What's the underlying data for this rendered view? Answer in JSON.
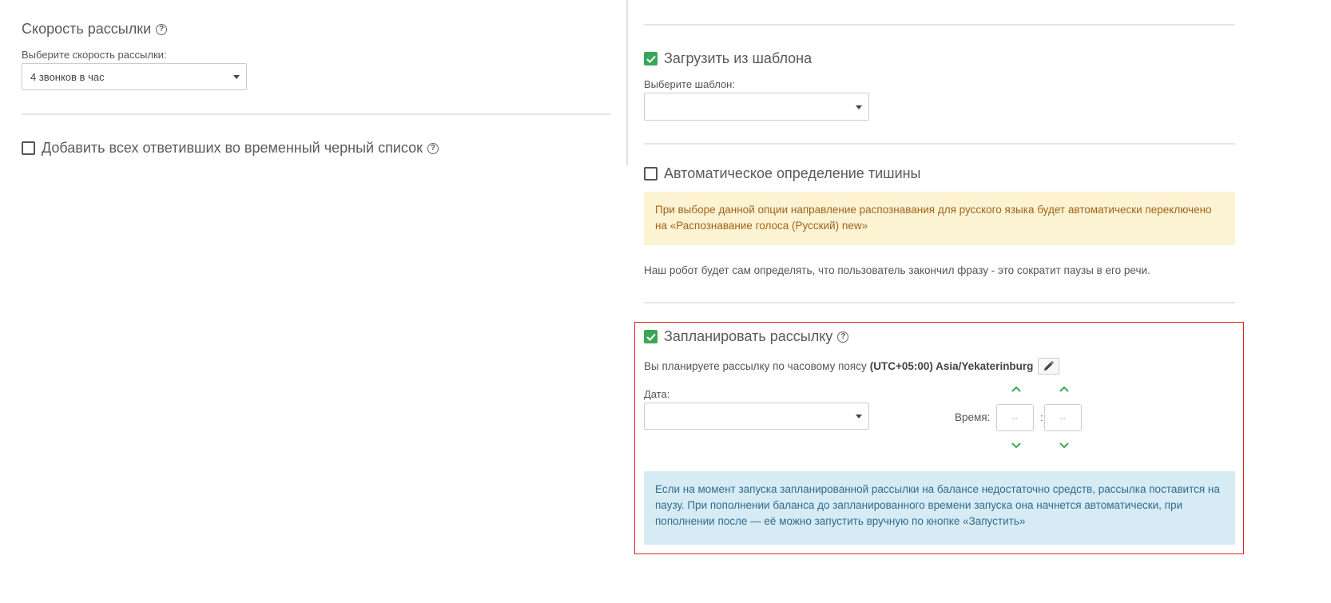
{
  "left": {
    "speed_title": "Скорость рассылки",
    "speed_label": "Выберите скорость рассылки:",
    "speed_value": "4 звонков в час",
    "blacklist_label": "Добавить всех ответивших во временный черный список"
  },
  "right": {
    "template_checkbox_label": "Загрузить из шаблона",
    "template_select_label": "Выберите шаблон:",
    "template_select_value": "",
    "silence_checkbox_label": "Автоматическое определение тишины",
    "silence_warning": "При выборе данной опции направление распознавания для русского языка будет автоматически переключено на «Распознавание голоса (Русский) new»",
    "silence_description": "Наш робот будет сам определять, что пользователь закончил фразу - это сократит паузы в его речи.",
    "schedule_checkbox_label": "Запланировать рассылку",
    "timezone_prefix": "Вы планируете рассылку по часовому поясу",
    "timezone_value": "(UTC+05:00) Asia/Yekaterinburg",
    "date_label": "Дата:",
    "date_value": "",
    "time_label": "Время:",
    "hours_value": "--",
    "minutes_value": "--",
    "time_separator": ":",
    "balance_info": "Если на момент запуска запланированной рассылки на балансе недостаточно средств, рассылка поставится на паузу. При пополнении баланса до запланированного времени запуска она начнется автоматически, при пополнении после — её можно запустить вручную по кнопке «Запустить»"
  },
  "icons": {
    "help": "?",
    "check": "check-icon",
    "edit": "pencil-icon",
    "up": "chevron-up-icon",
    "down": "chevron-down-icon"
  },
  "colors": {
    "checkbox_checked": "#3aa757",
    "warning_bg": "#fcf3d3",
    "warning_text": "#a2631a",
    "info_bg": "#d7ebf5",
    "info_text": "#2f6b8c",
    "highlight_border": "#e02424"
  }
}
